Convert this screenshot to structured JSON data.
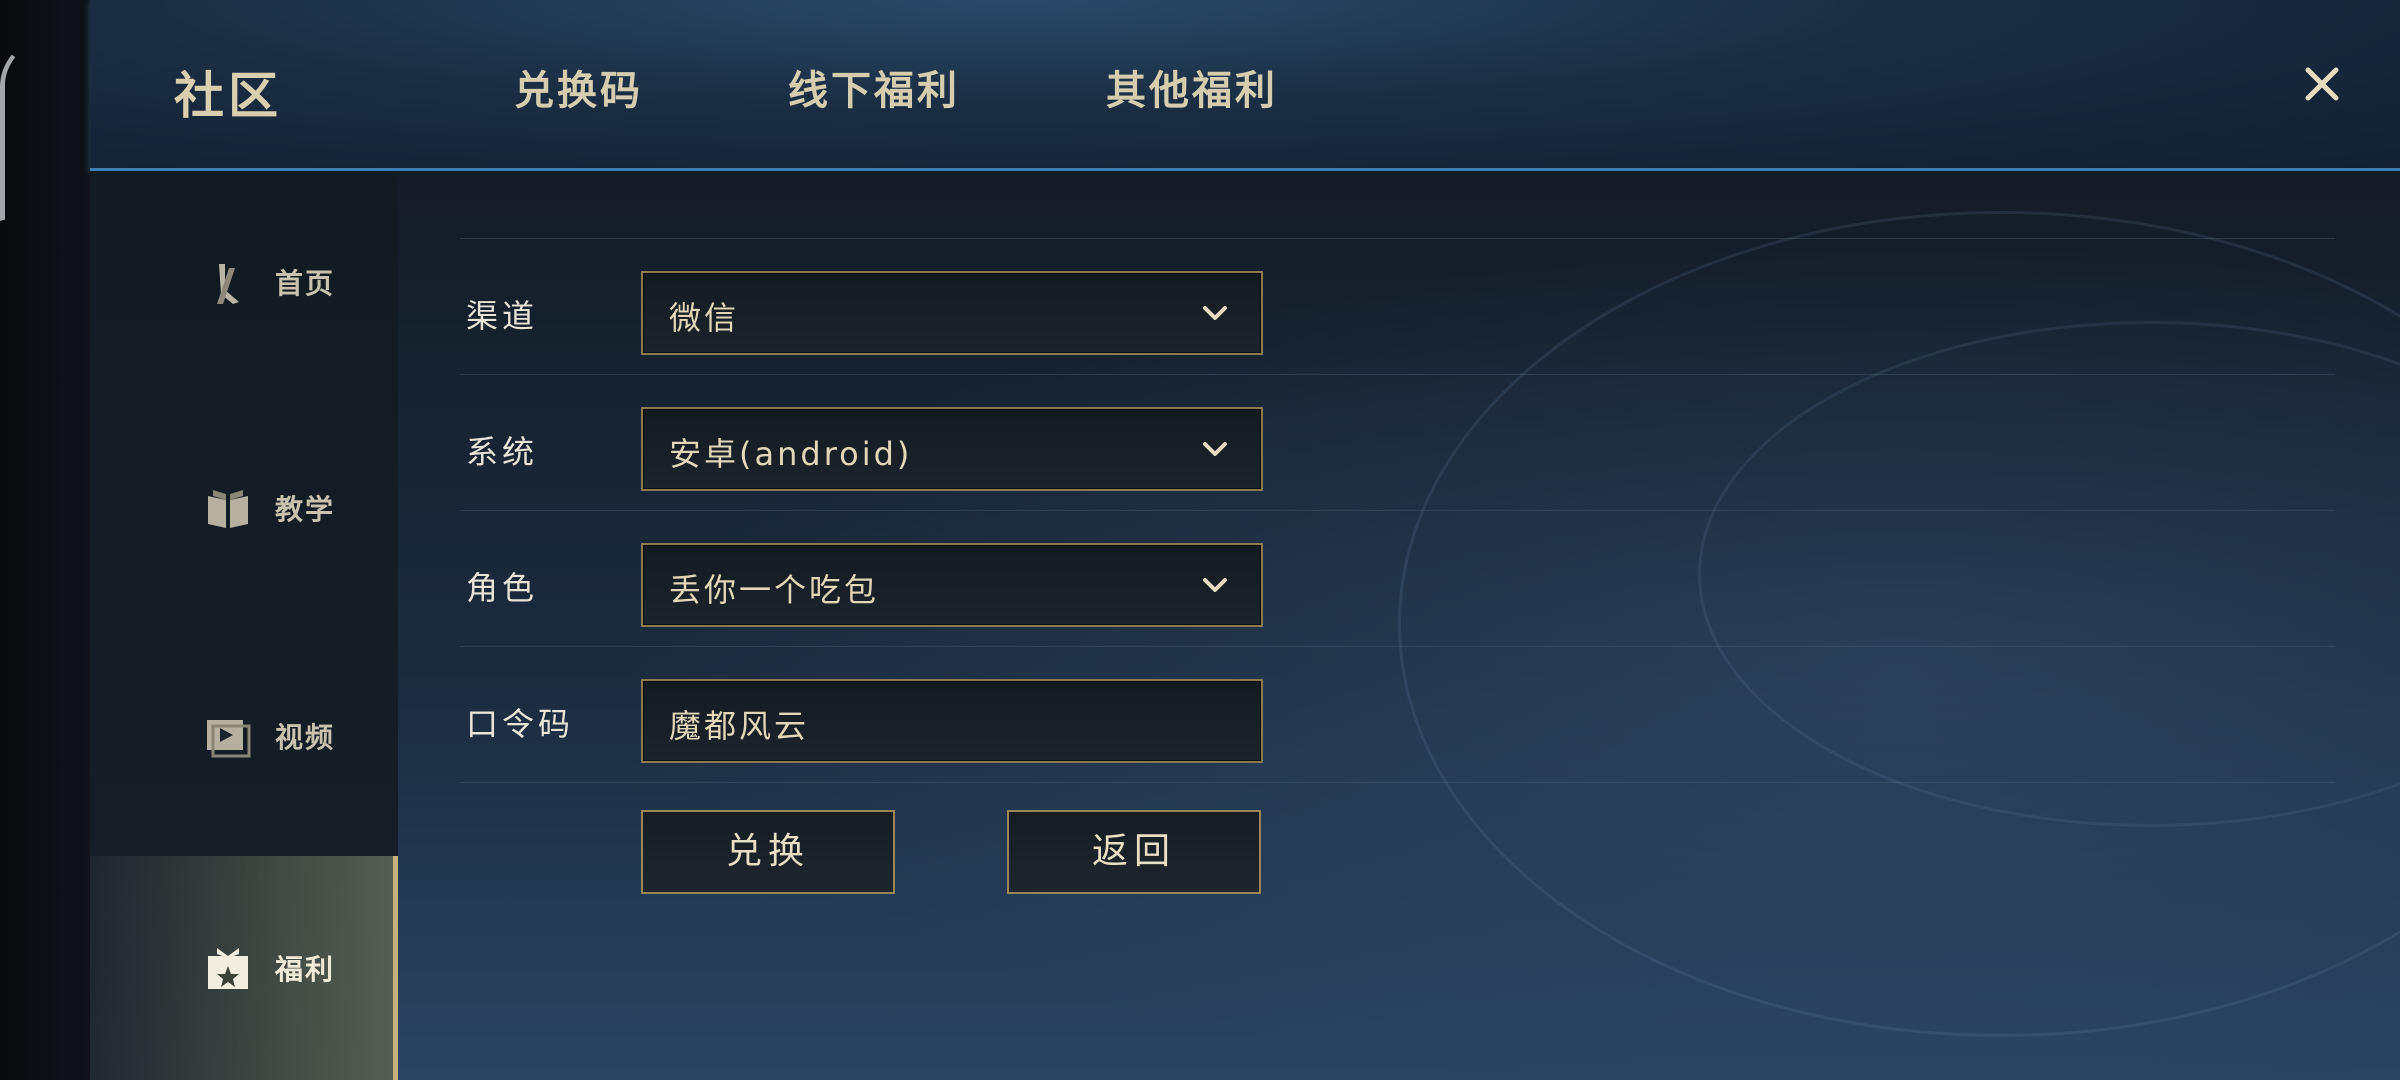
{
  "header": {
    "title": "社区",
    "tabs": [
      {
        "label": "兑换码"
      },
      {
        "label": "线下福利"
      },
      {
        "label": "其他福利"
      }
    ],
    "close_icon": "close-icon"
  },
  "sidebar": {
    "items": [
      {
        "label": "首页",
        "icon": "sword-icon"
      },
      {
        "label": "教学",
        "icon": "book-icon"
      },
      {
        "label": "视频",
        "icon": "video-icon"
      },
      {
        "label": "福利",
        "icon": "gift-icon",
        "active": true
      }
    ]
  },
  "form": {
    "channel": {
      "label": "渠道",
      "value": "微信"
    },
    "system": {
      "label": "系统",
      "value": "安卓(android)"
    },
    "role": {
      "label": "角色",
      "value": "丢你一个吃包"
    },
    "code": {
      "label": "口令码",
      "value": "魔都风云"
    },
    "redeem_label": "兑换",
    "back_label": "返回"
  },
  "colors": {
    "accent_gold": "#c7b07a",
    "header_line": "#3f7fb5",
    "text_gold": "#e2d7b8"
  }
}
